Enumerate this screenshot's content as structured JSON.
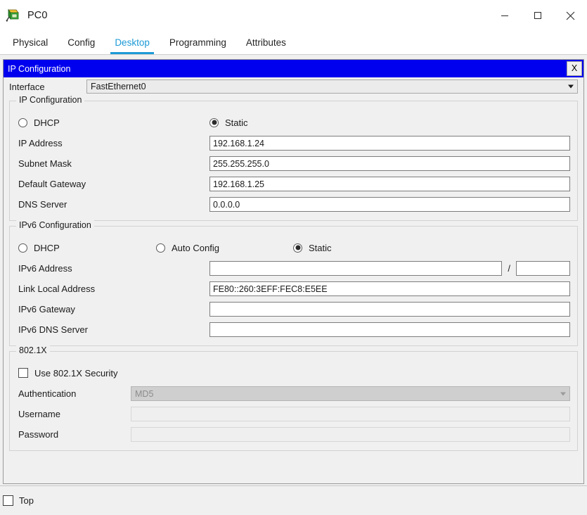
{
  "window": {
    "title": "PC0",
    "icon": "pc-device-icon",
    "controls": {
      "minimize": "minimize-icon",
      "maximize": "maximize-icon",
      "close": "close-icon"
    }
  },
  "tabs": [
    {
      "label": "Physical",
      "active": false
    },
    {
      "label": "Config",
      "active": false
    },
    {
      "label": "Desktop",
      "active": true
    },
    {
      "label": "Programming",
      "active": false
    },
    {
      "label": "Attributes",
      "active": false
    }
  ],
  "accent_color": "#1c9ad6",
  "inner_window": {
    "title": "IP Configuration",
    "title_bg": "#0000ee",
    "close_label": "X"
  },
  "interface": {
    "label": "Interface",
    "value": "FastEthernet0"
  },
  "ipv4": {
    "group_title": "IP Configuration",
    "mode": {
      "dhcp": {
        "label": "DHCP",
        "checked": false
      },
      "static": {
        "label": "Static",
        "checked": true
      }
    },
    "fields": [
      {
        "label": "IP Address",
        "value": "192.168.1.24",
        "disabled": false
      },
      {
        "label": "Subnet Mask",
        "value": "255.255.255.0",
        "disabled": false
      },
      {
        "label": "Default Gateway",
        "value": "192.168.1.25",
        "disabled": false
      },
      {
        "label": "DNS Server",
        "value": "0.0.0.0",
        "disabled": false
      }
    ]
  },
  "ipv6": {
    "group_title": "IPv6 Configuration",
    "mode": {
      "dhcp": {
        "label": "DHCP",
        "checked": false
      },
      "auto_config": {
        "label": "Auto Config",
        "checked": false
      },
      "static": {
        "label": "Static",
        "checked": true
      }
    },
    "address_row": {
      "label": "IPv6 Address",
      "value": "",
      "separator": "/",
      "prefix_value": ""
    },
    "fields": [
      {
        "label": "Link Local Address",
        "value": "FE80::260:3EFF:FEC8:E5EE",
        "disabled": false
      },
      {
        "label": "IPv6 Gateway",
        "value": "",
        "disabled": false
      },
      {
        "label": "IPv6 DNS Server",
        "value": "",
        "disabled": false
      }
    ]
  },
  "dot1x": {
    "group_title": "802.1X",
    "use_security": {
      "label": "Use 802.1X Security",
      "checked": false
    },
    "authentication": {
      "label": "Authentication",
      "value": "MD5",
      "disabled": true
    },
    "username": {
      "label": "Username",
      "value": "",
      "disabled": true
    },
    "password": {
      "label": "Password",
      "value": "",
      "disabled": true
    }
  },
  "bottom": {
    "top_checkbox": {
      "label": "Top",
      "checked": false
    }
  }
}
